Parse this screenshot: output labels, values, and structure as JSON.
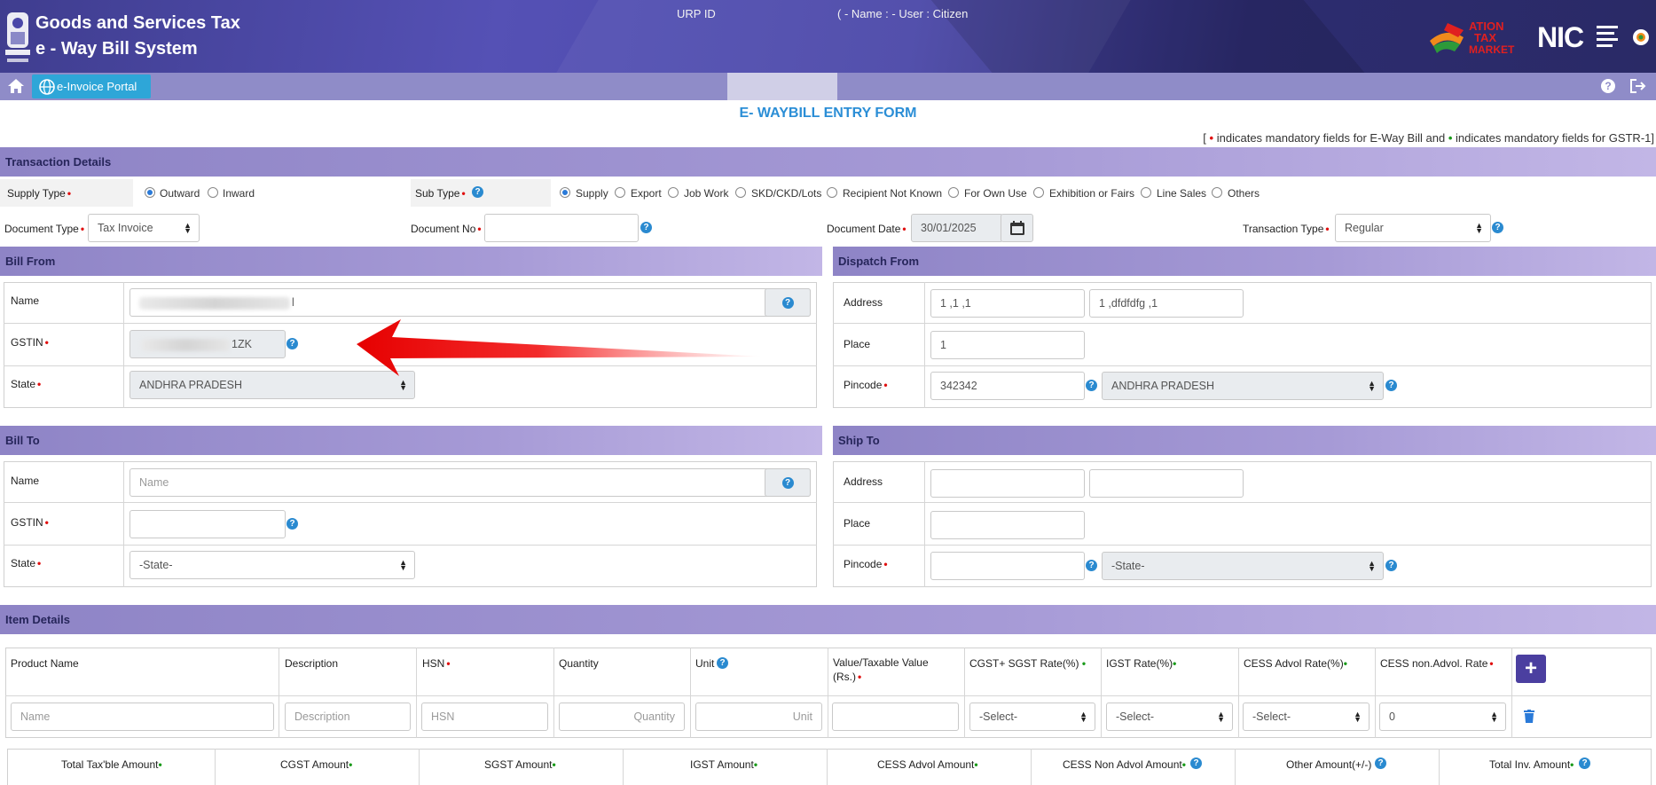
{
  "header": {
    "title_line1": "Goods and Services Tax",
    "title_line2": "e - Way Bill System",
    "brand_logo_text": "NATION TAX MARKET",
    "nic_text": "NIC"
  },
  "nav": {
    "einvoice_label": "e-Invoice Portal",
    "urp_label": "URP ID",
    "user_info": "( - Name : - User : Citizen"
  },
  "form": {
    "title": "E- WAYBILL ENTRY FORM",
    "legend_open": "[",
    "legend_text1": "indicates mandatory fields for E-Way Bill and",
    "legend_text2": "indicates mandatory fields for GSTR-1]",
    "transaction": {
      "section_title": "Transaction Details",
      "supply_type_label": "Supply Type",
      "supply_options": [
        "Outward",
        "Inward"
      ],
      "supply_selected": "Outward",
      "sub_type_label": "Sub Type",
      "sub_options": [
        "Supply",
        "Export",
        "Job Work",
        "SKD/CKD/Lots",
        "Recipient Not Known",
        "For Own Use",
        "Exhibition or Fairs",
        "Line Sales",
        "Others"
      ],
      "sub_selected": "Supply",
      "doc_type_label": "Document Type",
      "doc_type_value": "Tax Invoice",
      "doc_no_label": "Document No",
      "doc_no_value": "",
      "doc_date_label": "Document Date",
      "doc_date_value": "30/01/2025",
      "tx_type_label": "Transaction Type",
      "tx_type_value": "Regular"
    },
    "bill_from": {
      "section_title": "Bill From",
      "name_label": "Name",
      "name_value_tail": "l",
      "gstin_label": "GSTIN",
      "gstin_value_tail": "1ZK",
      "state_label": "State",
      "state_value": "ANDHRA PRADESH"
    },
    "dispatch_from": {
      "section_title": "Dispatch From",
      "address_label": "Address",
      "address1": "1 ,1 ,1",
      "address2": "1 ,dfdfdfg ,1",
      "place_label": "Place",
      "place_value": "1",
      "pincode_label": "Pincode",
      "pincode_value": "342342",
      "state_value": "ANDHRA PRADESH"
    },
    "bill_to": {
      "section_title": "Bill To",
      "name_label": "Name",
      "name_placeholder": "Name",
      "gstin_label": "GSTIN",
      "state_label": "State",
      "state_value": "-State-"
    },
    "ship_to": {
      "section_title": "Ship To",
      "address_label": "Address",
      "place_label": "Place",
      "pincode_label": "Pincode",
      "state_value": "-State-"
    },
    "items": {
      "section_title": "Item Details",
      "headers": [
        "Product Name",
        "Description",
        "HSN",
        "Quantity",
        "Unit",
        "Value/Taxable Value",
        "(Rs.)",
        "CGST+ SGST Rate(%)",
        "IGST Rate(%)",
        "CESS Advol Rate(%)",
        "CESS non.Advol. Rate"
      ],
      "placeholders": [
        "Name",
        "Description",
        "HSN",
        "Quantity",
        "Unit"
      ],
      "select_value": "-Select-",
      "cess_non_advol_value": "0"
    },
    "totals": {
      "labels": [
        "Total Tax'ble Amount",
        "CGST Amount",
        "SGST Amount",
        "IGST Amount",
        "CESS Advol Amount",
        "CESS Non Advol Amount",
        "Other Amount(+/-)",
        "Total Inv. Amount"
      ]
    }
  },
  "colors": {
    "header_bg": "#4a47a8",
    "nav_bg": "#8f8cc8",
    "section_bg": "#a69ad6",
    "accent": "#2b8ed6",
    "required": "#e01010",
    "gstr_required": "#1a9a1a"
  }
}
